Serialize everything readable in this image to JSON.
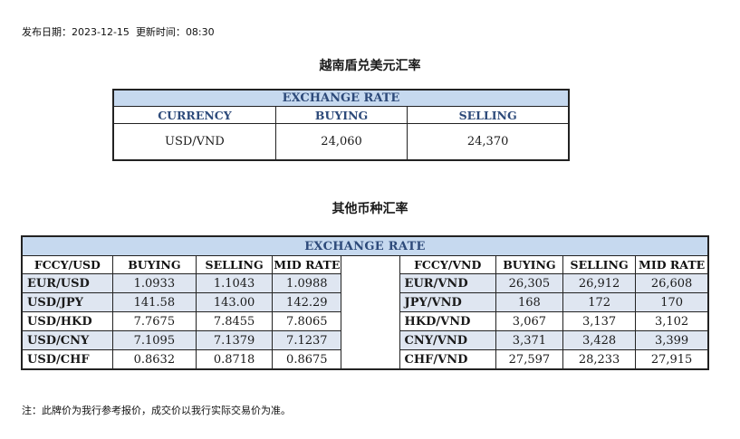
{
  "header": {
    "publish_date_label": "发布日期：",
    "publish_date": "2023-12-15",
    "update_time_label": "更新时间：",
    "update_time": "08:30"
  },
  "vnd_section": {
    "title": "越南盾兑美元汇率",
    "table_title": "EXCHANGE RATE",
    "columns": [
      "CURRENCY",
      "BUYING",
      "SELLING"
    ],
    "row": {
      "currency": "USD/VND",
      "buying": "24,060",
      "selling": "24,370"
    }
  },
  "other_section": {
    "title": "其他币种汇率",
    "table_title": "EXCHANGE  RATE",
    "left_columns": [
      "FCCY/USD",
      "BUYING",
      "SELLING",
      "MID RATE"
    ],
    "right_columns": [
      "FCCY/VND",
      "BUYING",
      "SELLING",
      "MID RATE"
    ],
    "rows": [
      {
        "l_pair": "EUR/USD",
        "l_buy": "1.0933",
        "l_sell": "1.1043",
        "l_mid": "1.0988",
        "r_pair": "EUR/VND",
        "r_buy": "26,305",
        "r_sell": "26,912",
        "r_mid": "26,608"
      },
      {
        "l_pair": "USD/JPY",
        "l_buy": "141.58",
        "l_sell": "143.00",
        "l_mid": "142.29",
        "r_pair": "JPY/VND",
        "r_buy": "168",
        "r_sell": "172",
        "r_mid": "170"
      },
      {
        "l_pair": "USD/HKD",
        "l_buy": "7.7675",
        "l_sell": "7.8455",
        "l_mid": "7.8065",
        "r_pair": "HKD/VND",
        "r_buy": "3,067",
        "r_sell": "3,137",
        "r_mid": "3,102"
      },
      {
        "l_pair": "USD/CNY",
        "l_buy": "7.1095",
        "l_sell": "7.1379",
        "l_mid": "7.1237",
        "r_pair": "CNY/VND",
        "r_buy": "3,371",
        "r_sell": "3,428",
        "r_mid": "3,399"
      },
      {
        "l_pair": "USD/CHF",
        "l_buy": "0.8632",
        "l_sell": "0.8718",
        "l_mid": "0.8675",
        "r_pair": "CHF/VND",
        "r_buy": "27,597",
        "r_sell": "28,233",
        "r_mid": "27,915"
      }
    ]
  },
  "footnote": "注：此牌价为我行参考报价，成交价以我行实际交易价为准。",
  "colors": {
    "header_fill": "#c6d9ef",
    "header_text": "#2d4a7a",
    "alt_row_fill": "#dfe6f1"
  }
}
